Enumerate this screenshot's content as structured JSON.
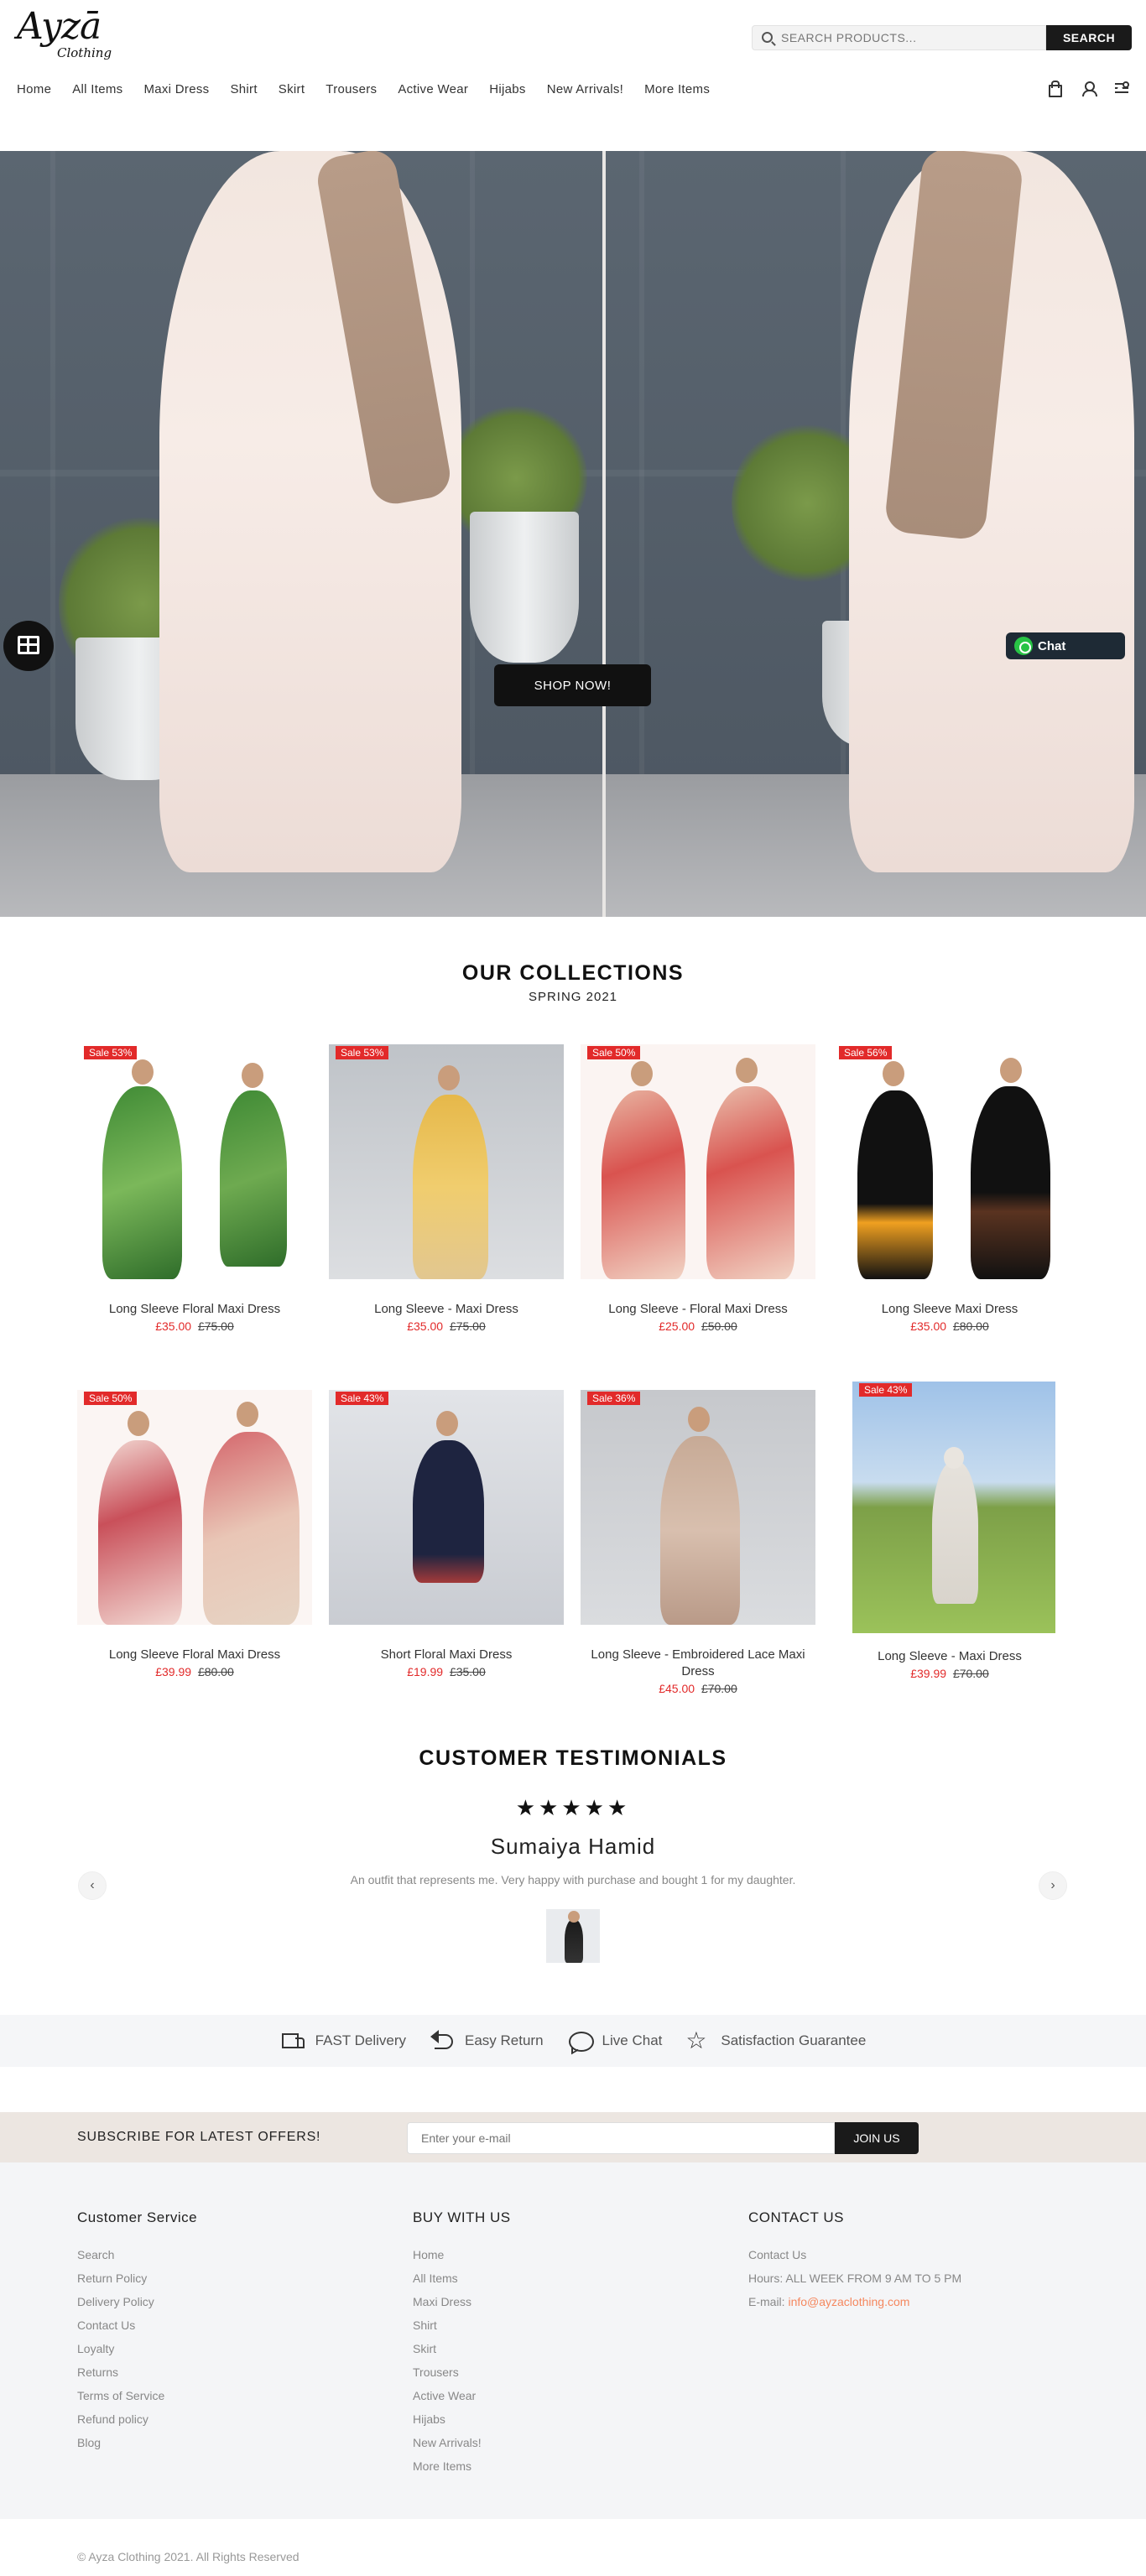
{
  "brand": {
    "logo_main": "Ayzā",
    "logo_sub": "Clothing"
  },
  "search": {
    "placeholder": "SEARCH PRODUCTS...",
    "button": "SEARCH"
  },
  "nav": [
    "Home",
    "All Items",
    "Maxi Dress",
    "Shirt",
    "Skirt",
    "Trousers",
    "Active Wear",
    "Hijabs",
    "New Arrivals!",
    "More Items"
  ],
  "header_icons": [
    "bag-icon",
    "user-icon",
    "filter-icon"
  ],
  "hero": {
    "cta": "SHOP NOW!",
    "chat_label": "Chat"
  },
  "collections": {
    "title": "OUR COLLECTIONS",
    "subtitle": "SPRING 2021",
    "products": [
      {
        "badge": "Sale 53%",
        "name": "Long Sleeve Floral Maxi Dress",
        "price": "£35.00",
        "old_price": "£75.00"
      },
      {
        "badge": "Sale 53%",
        "name": "Long Sleeve - Maxi Dress",
        "price": "£35.00",
        "old_price": "£75.00"
      },
      {
        "badge": "Sale 50%",
        "name": "Long Sleeve - Floral Maxi Dress",
        "price": "£25.00",
        "old_price": "£50.00"
      },
      {
        "badge": "Sale 56%",
        "name": "Long Sleeve Maxi Dress",
        "price": "£35.00",
        "old_price": "£80.00"
      },
      {
        "badge": "Sale 50%",
        "name": "Long Sleeve Floral Maxi Dress",
        "price": "£39.99",
        "old_price": "£80.00"
      },
      {
        "badge": "Sale 43%",
        "name": "Short Floral Maxi Dress",
        "price": "£19.99",
        "old_price": "£35.00"
      },
      {
        "badge": "Sale 36%",
        "name": "Long Sleeve - Embroidered Lace Maxi Dress",
        "price": "£45.00",
        "old_price": "£70.00"
      },
      {
        "badge": "Sale 43%",
        "name": "Long Sleeve - Maxi Dress",
        "price": "£39.99",
        "old_price": "£70.00"
      }
    ]
  },
  "testimonials": {
    "title": "CUSTOMER TESTIMONIALS",
    "stars": "★★★★★",
    "name": "Sumaiya Hamid",
    "quote": "An outfit that represents me. Very happy with purchase and bought 1 for my daughter.",
    "prev": "‹",
    "next": "›"
  },
  "features": [
    "FAST Delivery",
    "Easy Return",
    "Live Chat",
    "Satisfaction Guarantee"
  ],
  "subscribe": {
    "label": "SUBSCRIBE FOR LATEST OFFERS!",
    "placeholder": "Enter your e-mail",
    "button": "JOIN US"
  },
  "footer": {
    "customer_service": {
      "title": "Customer Service",
      "links": [
        "Search",
        "Return Policy",
        "Delivery Policy",
        "Contact Us",
        "Loyalty",
        "Returns",
        "Terms of Service",
        "Refund policy",
        "Blog"
      ]
    },
    "buy_with_us": {
      "title": "BUY WITH US",
      "links": [
        "Home",
        "All Items",
        "Maxi Dress",
        "Shirt",
        "Skirt",
        "Trousers",
        "Active Wear",
        "Hijabs",
        "New Arrivals!",
        "More Items"
      ]
    },
    "contact": {
      "title": "CONTACT US",
      "contact_link": "Contact Us",
      "hours_label": "Hours:",
      "hours": "ALL WEEK FROM 9 AM TO 5 PM",
      "email_label": "E-mail:",
      "email": "info@ayzaclothing.com"
    },
    "copyright": "© Ayza Clothing 2021. All Rights Reserved"
  },
  "colors": {
    "accent_dark": "#1a1a1a",
    "sale_red": "#e22a2a",
    "email_orange": "#f5885f",
    "subscribe_bg": "#ece6e1",
    "footer_bg": "#f4f5f7"
  }
}
